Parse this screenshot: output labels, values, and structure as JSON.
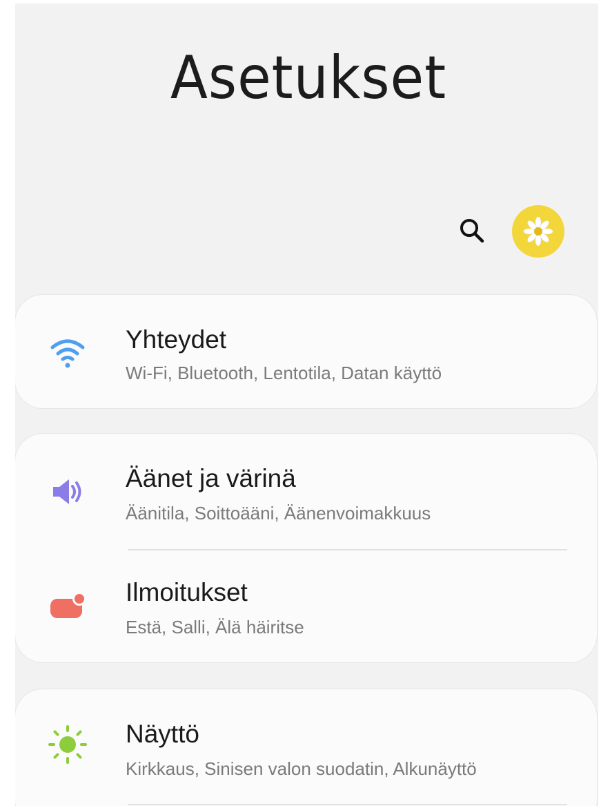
{
  "header": {
    "title": "Asetukset",
    "search_icon": "search-icon",
    "avatar_icon": "daisy-profile-icon",
    "avatar_color": "#f2d63a"
  },
  "sections": [
    {
      "items": [
        {
          "icon": "wifi-icon",
          "icon_color": "#4f9ef0",
          "title": "Yhteydet",
          "subtitle": "Wi-Fi, Bluetooth, Lentotila, Datan käyttö"
        }
      ]
    },
    {
      "items": [
        {
          "icon": "sound-icon",
          "icon_color": "#8a7de8",
          "title": "Äänet ja värinä",
          "subtitle": "Äänitila, Soittoääni, Äänenvoimakkuus"
        },
        {
          "icon": "notification-icon",
          "icon_color": "#ef6f63",
          "title": "Ilmoitukset",
          "subtitle": "Estä, Salli, Älä häiritse"
        }
      ]
    },
    {
      "items": [
        {
          "icon": "display-brightness-icon",
          "icon_color": "#8ccd3c",
          "title": "Näyttö",
          "subtitle": "Kirkkaus, Sinisen valon suodatin, Alkunäyttö"
        }
      ]
    }
  ]
}
